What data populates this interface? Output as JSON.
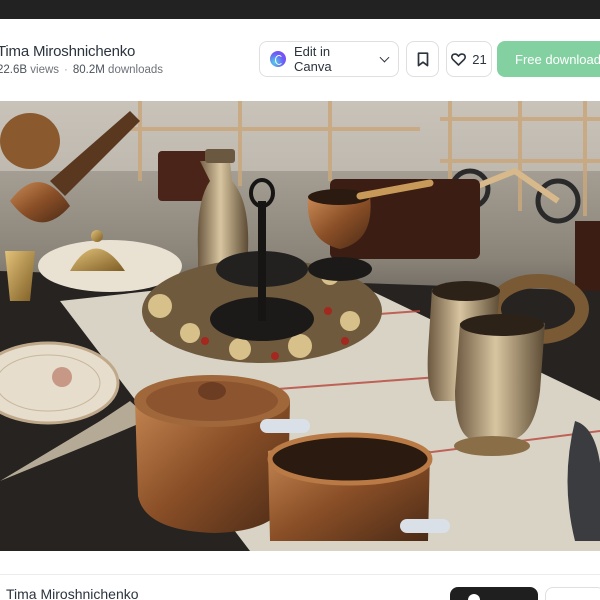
{
  "author": {
    "name": "Tima Miroshnichenko"
  },
  "stats": {
    "views_value": "22.6B",
    "views_label": "views",
    "downloads_value": "80.2M",
    "downloads_label": "downloads"
  },
  "actions": {
    "edit_label": "Edit in Canva",
    "like_count": "21",
    "download_label": "Free download"
  },
  "icons": {
    "edit": "canva-logo-icon",
    "edit_menu": "chevron-down-icon",
    "bookmark": "bookmark-icon",
    "like": "heart-icon"
  },
  "colors": {
    "download_button": "#83d1a1",
    "top_bar": "#222222",
    "text": "#2c343e"
  },
  "footer": {
    "author_name": "Tima Miroshnichenko"
  }
}
